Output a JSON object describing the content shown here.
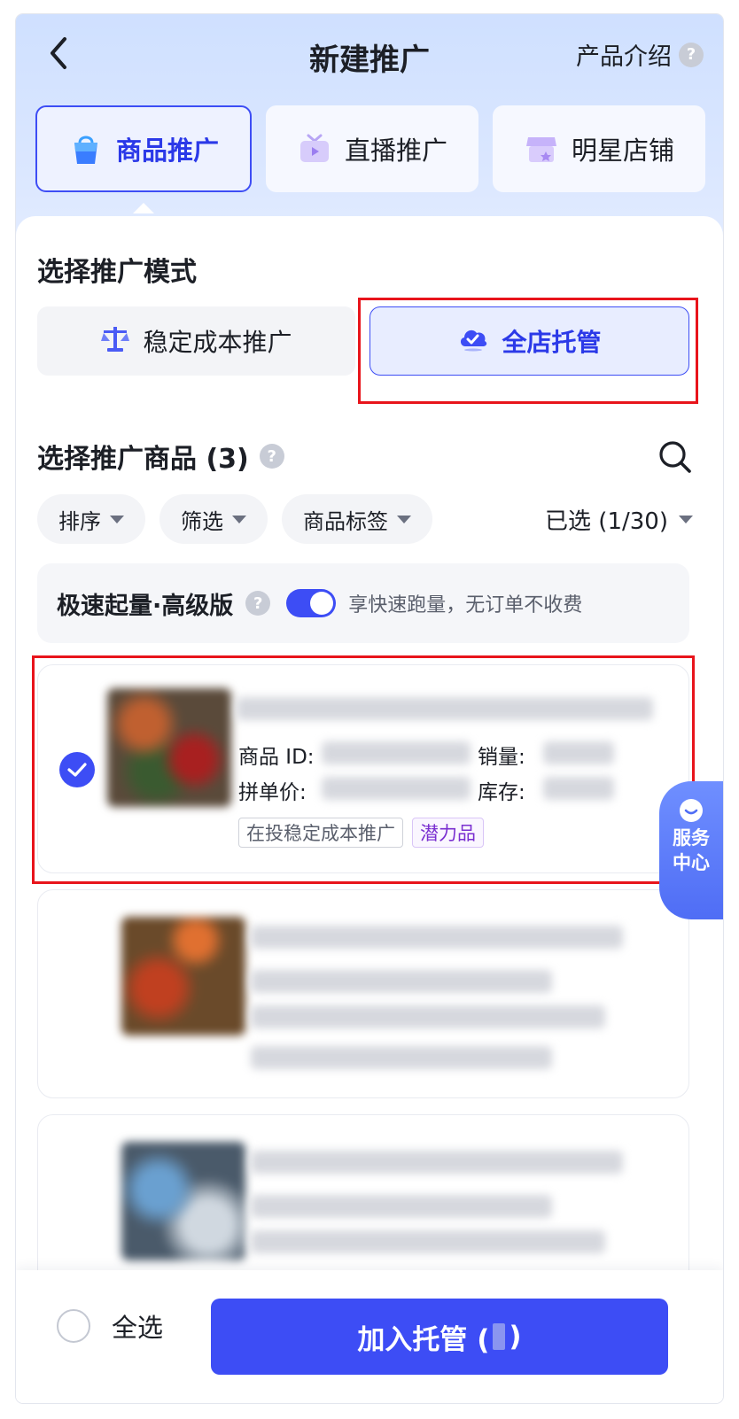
{
  "header": {
    "title": "新建推广",
    "intro_label": "产品介绍",
    "help_glyph": "?"
  },
  "type_tabs": [
    {
      "label": "商品推广",
      "icon": "shopping-bag-icon",
      "active": true
    },
    {
      "label": "直播推广",
      "icon": "tv-icon",
      "active": false
    },
    {
      "label": "明星店铺",
      "icon": "store-icon",
      "active": false
    }
  ],
  "mode": {
    "title": "选择推广模式",
    "options": [
      {
        "label": "稳定成本推广",
        "icon": "scale-icon",
        "active": false
      },
      {
        "label": "全店托管",
        "icon": "cloud-check-icon",
        "active": true
      }
    ]
  },
  "products": {
    "title": "选择推广商品 (3)",
    "filters": [
      {
        "label": "排序"
      },
      {
        "label": "筛选"
      },
      {
        "label": "商品标签"
      }
    ],
    "selected_count": "已选 (1/30)"
  },
  "boost": {
    "title": "极速起量·高级版",
    "enabled": true,
    "desc": "享快速跑量，无订单不收费"
  },
  "cards": [
    {
      "checked": true,
      "id_label": "商品 ID:",
      "sales_label": "销量:",
      "price_label": "拼单价:",
      "stock_label": "库存:",
      "tags": [
        "在投稳定成本推广",
        "潜力品"
      ]
    }
  ],
  "service": {
    "line1": "服务",
    "line2": "中心"
  },
  "footer": {
    "select_all": "全选",
    "submit_prefix": "加入托管 (",
    "submit_suffix": ")"
  },
  "colors": {
    "accent": "#3d4df5",
    "highlight": "#e8141b",
    "tag_purple": "#7a2fd0"
  }
}
